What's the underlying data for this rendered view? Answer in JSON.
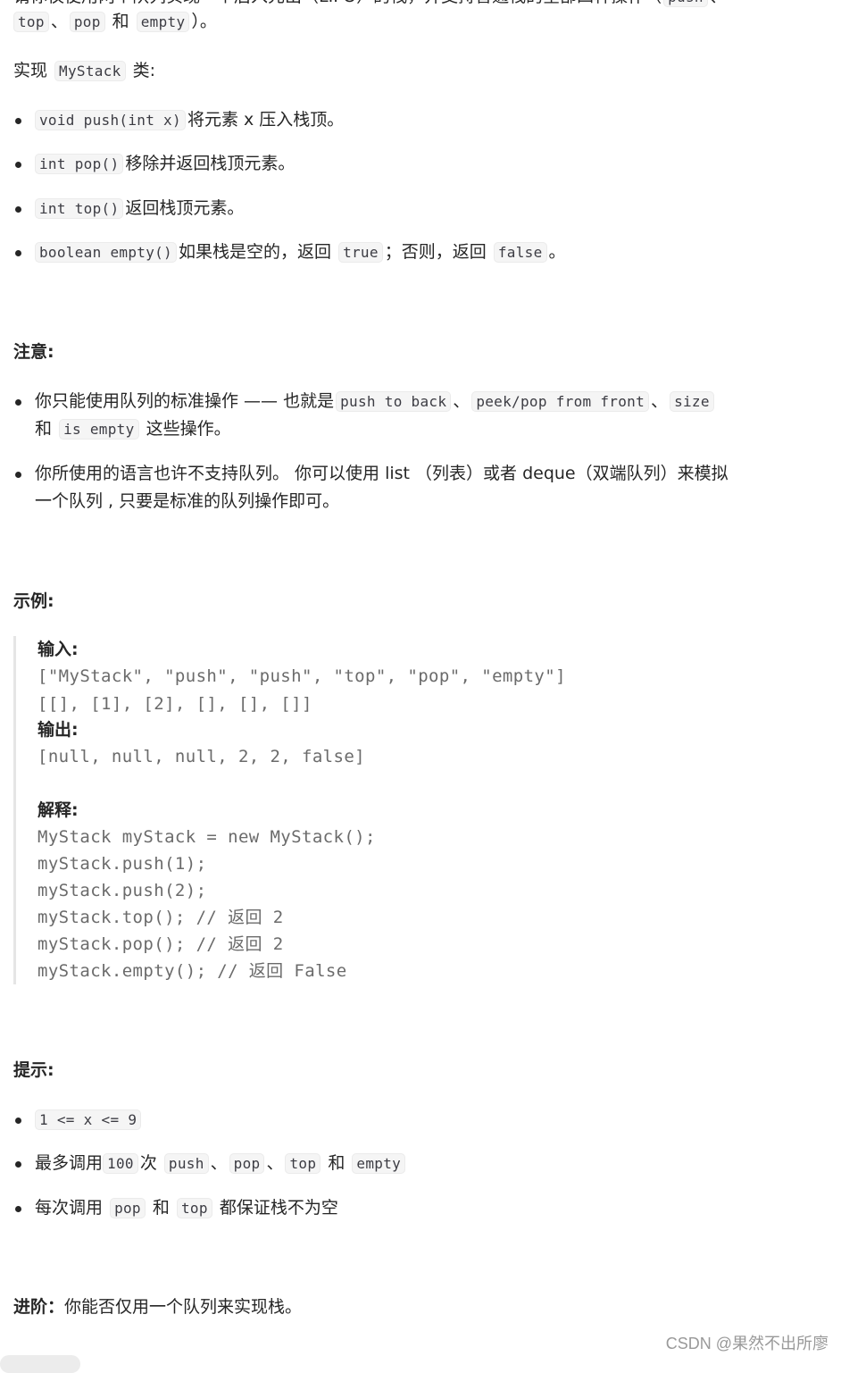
{
  "intro": {
    "clipped_line_text": "请你仅使用两个队列实现一个后入先出（LIFO）的栈，并支持普通栈的全部四种操作（",
    "clipped_line_code": "push",
    "clipped_line_end": "、",
    "line2": {
      "code1": "top",
      "sep1": "、",
      "code2": "pop",
      "and": " 和 ",
      "code3": "empty",
      "end": "）。"
    },
    "implement_prefix": "实现 ",
    "implement_code": "MyStack",
    "implement_suffix": " 类:"
  },
  "methods": [
    {
      "code": "void push(int x)",
      "desc": "将元素 x 压入栈顶。"
    },
    {
      "code": "int pop()",
      "desc": "移除并返回栈顶元素。"
    },
    {
      "code": "int top()",
      "desc": "返回栈顶元素。"
    },
    {
      "code": "boolean empty()",
      "desc": "如果栈是空的，返回",
      "code2": "true",
      "desc2": "；否则，返回",
      "code3": "false",
      "desc3": "。"
    }
  ],
  "notes": {
    "heading": "注意:",
    "items": [
      {
        "text1": "你只能使用队列的标准操作 —— 也就是",
        "code1": "push to back",
        "sep1": "、",
        "code2": "peek/pop from front",
        "sep2": "、",
        "code3": "size",
        "text2": "和",
        "code4": "is empty",
        "text3": "这些操作。"
      },
      {
        "text1": "你所使用的语言也许不支持队列。 你可以使用 list （列表）或者 deque（双端队列）来模拟",
        "text2": "一个队列 , 只要是标准的队列操作即可。"
      }
    ]
  },
  "example": {
    "heading": "示例:",
    "input_label": "输入:",
    "input_lines": [
      "[\"MyStack\", \"push\", \"push\", \"top\", \"pop\", \"empty\"]",
      "[[], [1], [2], [], [], []]"
    ],
    "output_label": "输出:",
    "output_lines": [
      "[null, null, null, 2, 2, false]"
    ],
    "explain_label": "解释:",
    "explain_lines": [
      "MyStack myStack = new MyStack();",
      "myStack.push(1);",
      "myStack.push(2);",
      "myStack.top(); // 返回 2",
      "myStack.pop(); // 返回 2",
      "myStack.empty(); // 返回 False"
    ]
  },
  "hints": {
    "heading": "提示:",
    "items": [
      {
        "code": "1 <= x <= 9"
      },
      {
        "text1": "最多调用",
        "code1": "100",
        "text2": "次",
        "code2": "push",
        "sep1": "、",
        "code3": "pop",
        "sep2": "、",
        "code4": "top",
        "text3": "和",
        "code5": "empty"
      },
      {
        "text1": "每次调用",
        "code1": "pop",
        "text2": "和",
        "code2": "top",
        "text3": "都保证栈不为空"
      }
    ]
  },
  "advanced": {
    "label": "进阶：",
    "text": "你能否仅用一个队列来实现栈。"
  },
  "watermark": "CSDN @果然不出所廖"
}
